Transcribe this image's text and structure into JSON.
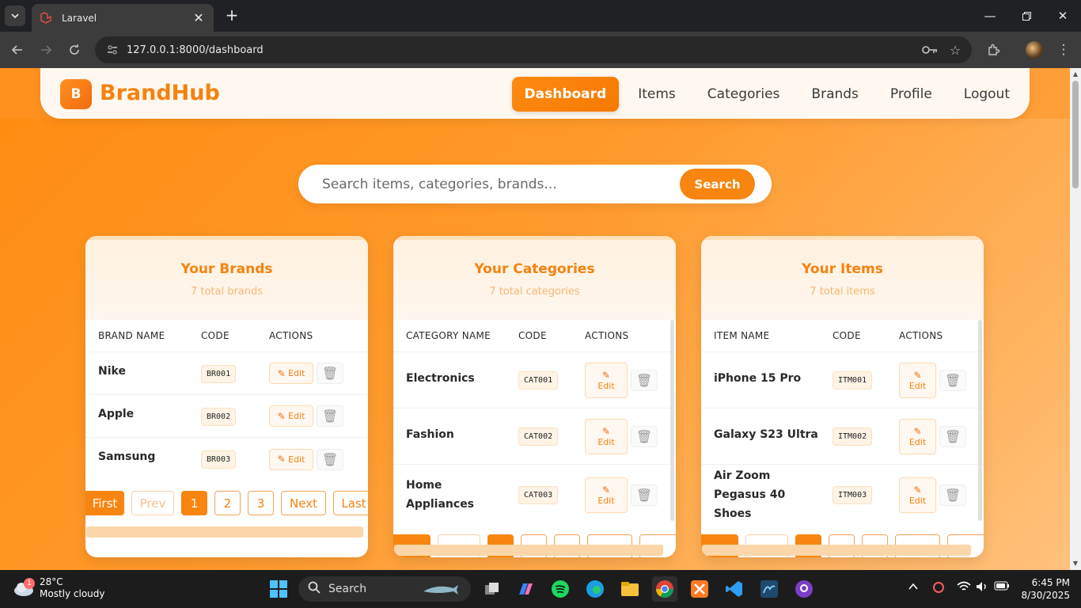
{
  "browser": {
    "tab_title": "Laravel",
    "url": "127.0.0.1:8000/dashboard"
  },
  "app": {
    "logo_letter": "B",
    "brand": "BrandHub",
    "nav": [
      "Dashboard",
      "Items",
      "Categories",
      "Brands",
      "Profile",
      "Logout"
    ],
    "active_nav": "Dashboard"
  },
  "search": {
    "placeholder": "Search items, categories, brands...",
    "button": "Search"
  },
  "brands_card": {
    "title": "Your Brands",
    "subtitle": "7 total brands",
    "headers": [
      "BRAND NAME",
      "CODE",
      "ACTIONS"
    ],
    "rows": [
      {
        "name": "Nike",
        "code": "BR001"
      },
      {
        "name": "Apple",
        "code": "BR002"
      },
      {
        "name": "Samsung",
        "code": "BR003"
      }
    ],
    "edit_label": "Edit",
    "pagination": [
      "First",
      "Prev",
      "1",
      "2",
      "3",
      "Next",
      "Last"
    ]
  },
  "categories_card": {
    "title": "Your Categories",
    "subtitle": "7 total categories",
    "headers": [
      "CATEGORY NAME",
      "CODE",
      "ACTIONS"
    ],
    "rows": [
      {
        "name": "Electronics",
        "code": "CAT001"
      },
      {
        "name": "Fashion",
        "code": "CAT002"
      },
      {
        "name": "Home Appliances",
        "code": "CAT003"
      }
    ],
    "edit_label": "Edit"
  },
  "items_card": {
    "title": "Your Items",
    "subtitle": "7 total items",
    "headers": [
      "ITEM NAME",
      "CODE",
      "ACTIONS"
    ],
    "rows": [
      {
        "name": "iPhone 15 Pro",
        "code": "ITM001"
      },
      {
        "name": "Galaxy S23 Ultra",
        "code": "ITM002"
      },
      {
        "name": "Air Zoom Pegasus 40 Shoes",
        "code": "ITM003"
      }
    ],
    "edit_label": "Edit"
  },
  "taskbar": {
    "weather_badge": "1",
    "temperature": "28°C",
    "condition": "Mostly cloudy",
    "search": "Search",
    "time": "6:45 PM",
    "date": "8/30/2025"
  },
  "colors": {
    "accent": "#f7850f",
    "background": "#ff9a2c"
  }
}
